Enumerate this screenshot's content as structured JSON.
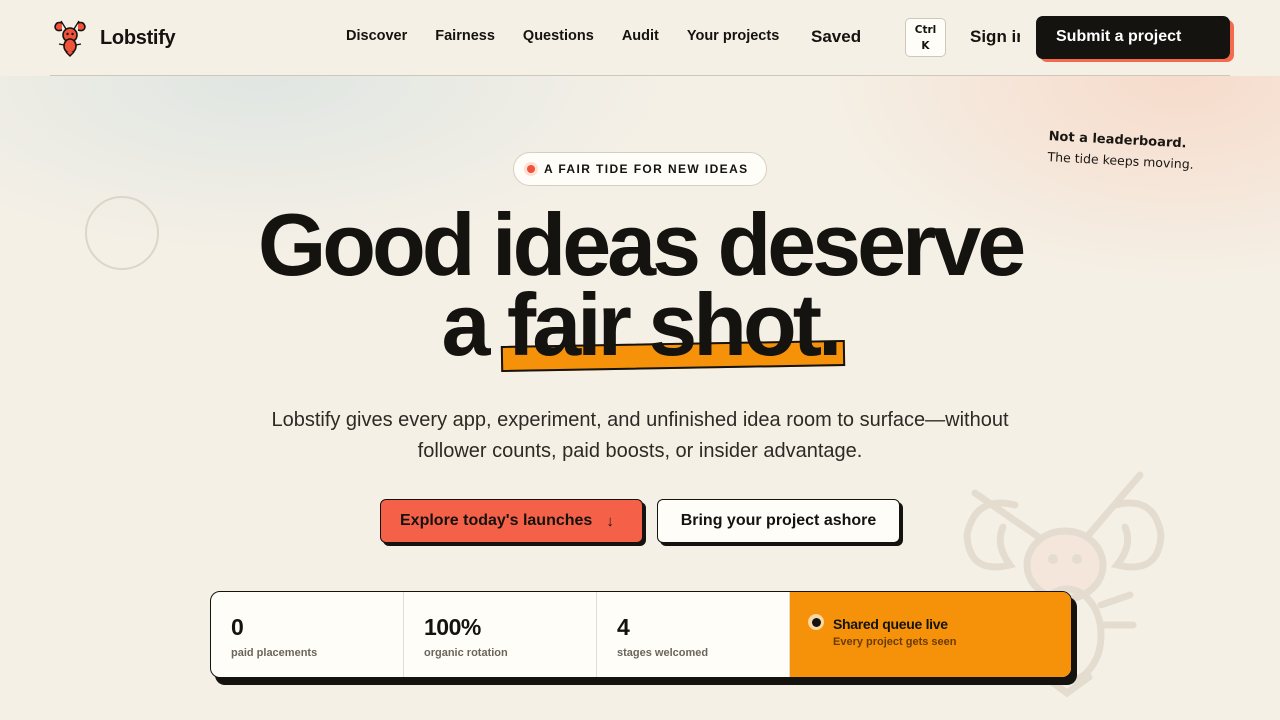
{
  "brand": {
    "name": "Lobstify",
    "logo_icon": "lobster-icon"
  },
  "nav": {
    "links": [
      "Discover",
      "Fairness",
      "Questions",
      "Audit",
      "Your projects"
    ],
    "saved": "Saved",
    "shortcut_top": "Ctrl",
    "shortcut_bottom": "K",
    "sign_in": "Sign in",
    "submit": "Submit a project"
  },
  "hero": {
    "badge": "A FAIR TIDE FOR NEW IDEAS",
    "headline_line1": "Good ideas deserve",
    "headline_a": "a",
    "headline_highlight": "fair shot.",
    "subhead": "Lobstify gives every app, experiment, and unfinished idea room to surface—without follower counts, paid boosts, or insider advantage.",
    "cta_primary": "Explore today's launches",
    "cta_primary_icon": "arrow-down-icon",
    "cta_secondary": "Bring your project ashore",
    "note_title": "Not a leaderboard.",
    "note_body": "The tide keeps moving."
  },
  "stats": [
    {
      "value": "0",
      "label": "paid placements"
    },
    {
      "value": "100%",
      "label": "organic rotation"
    },
    {
      "value": "4",
      "label": "stages welcomed"
    }
  ],
  "live": {
    "title": "Shared queue live",
    "subtitle": "Every project gets seen"
  },
  "colors": {
    "accent": "#f56048",
    "highlight": "#f59209",
    "ink": "#15130f",
    "background": "#f5f0e6"
  }
}
